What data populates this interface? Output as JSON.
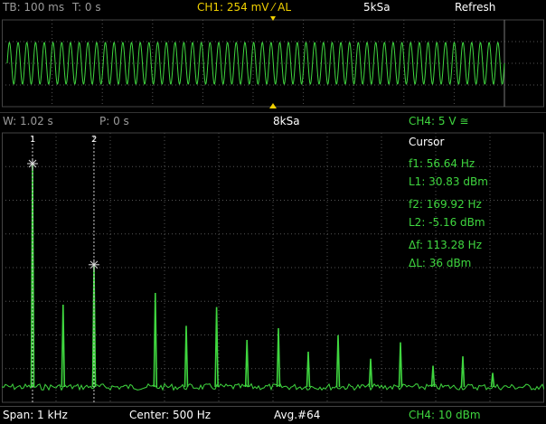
{
  "top_bar": {
    "timebase": "TB: 100 ms",
    "trigger_time": "T: 0 s",
    "channel1": "CH1: 254 mV ⁄ AL",
    "sample_rate": "5kSa",
    "mode": "Refresh"
  },
  "mid_bar": {
    "window": "W: 1.02 s",
    "position": "P: 0 s",
    "sample_rate": "8kSa",
    "channel4": "CH4: 5 V ≅"
  },
  "cursor": {
    "title": "Cursor",
    "f1": "f1: 56.64 Hz",
    "l1": "L1: 30.83 dBm",
    "f2": "f2: 169.92 Hz",
    "l2": "L2: -5.16 dBm",
    "df": "Δf: 113.28 Hz",
    "dl": "ΔL: 36 dBm",
    "marker1_label": "1",
    "marker2_label": "2"
  },
  "bottom_bar": {
    "span": "Span: 1 kHz",
    "center": "Center: 500 Hz",
    "average": "Avg.#64",
    "channel4": "CH4: 10 dBm"
  },
  "colors": {
    "trace": "#3fd63f",
    "grid": "#555555",
    "trigger": "#f0d000"
  },
  "chart_data": [
    {
      "type": "line",
      "title": "",
      "description_source": "time-domain waveform",
      "x_unit": "cycles",
      "cycles": 57,
      "grid": true
    },
    {
      "type": "line",
      "title": "",
      "xlim_hz": [
        0,
        1000
      ],
      "ylim_div": [
        0,
        10
      ],
      "grid": true,
      "peaks": [
        {
          "freq_hz": 56.64,
          "height_div": 9.5
        },
        {
          "freq_hz": 113,
          "height_div": 3.5
        },
        {
          "freq_hz": 169.92,
          "height_div": 5.2
        },
        {
          "freq_hz": 283,
          "height_div": 4.0
        },
        {
          "freq_hz": 396,
          "height_div": 3.4
        },
        {
          "freq_hz": 510,
          "height_div": 2.5
        },
        {
          "freq_hz": 620,
          "height_div": 2.2
        },
        {
          "freq_hz": 735,
          "height_div": 1.9
        },
        {
          "freq_hz": 850,
          "height_div": 1.3
        },
        {
          "freq_hz": 170,
          "height_div": 2.7
        },
        {
          "freq_hz": 340,
          "height_div": 2.6
        },
        {
          "freq_hz": 452,
          "height_div": 2.0
        },
        {
          "freq_hz": 565,
          "height_div": 1.5
        },
        {
          "freq_hz": 680,
          "height_div": 1.2
        },
        {
          "freq_hz": 795,
          "height_div": 0.9
        },
        {
          "freq_hz": 905,
          "height_div": 0.6
        }
      ]
    }
  ]
}
